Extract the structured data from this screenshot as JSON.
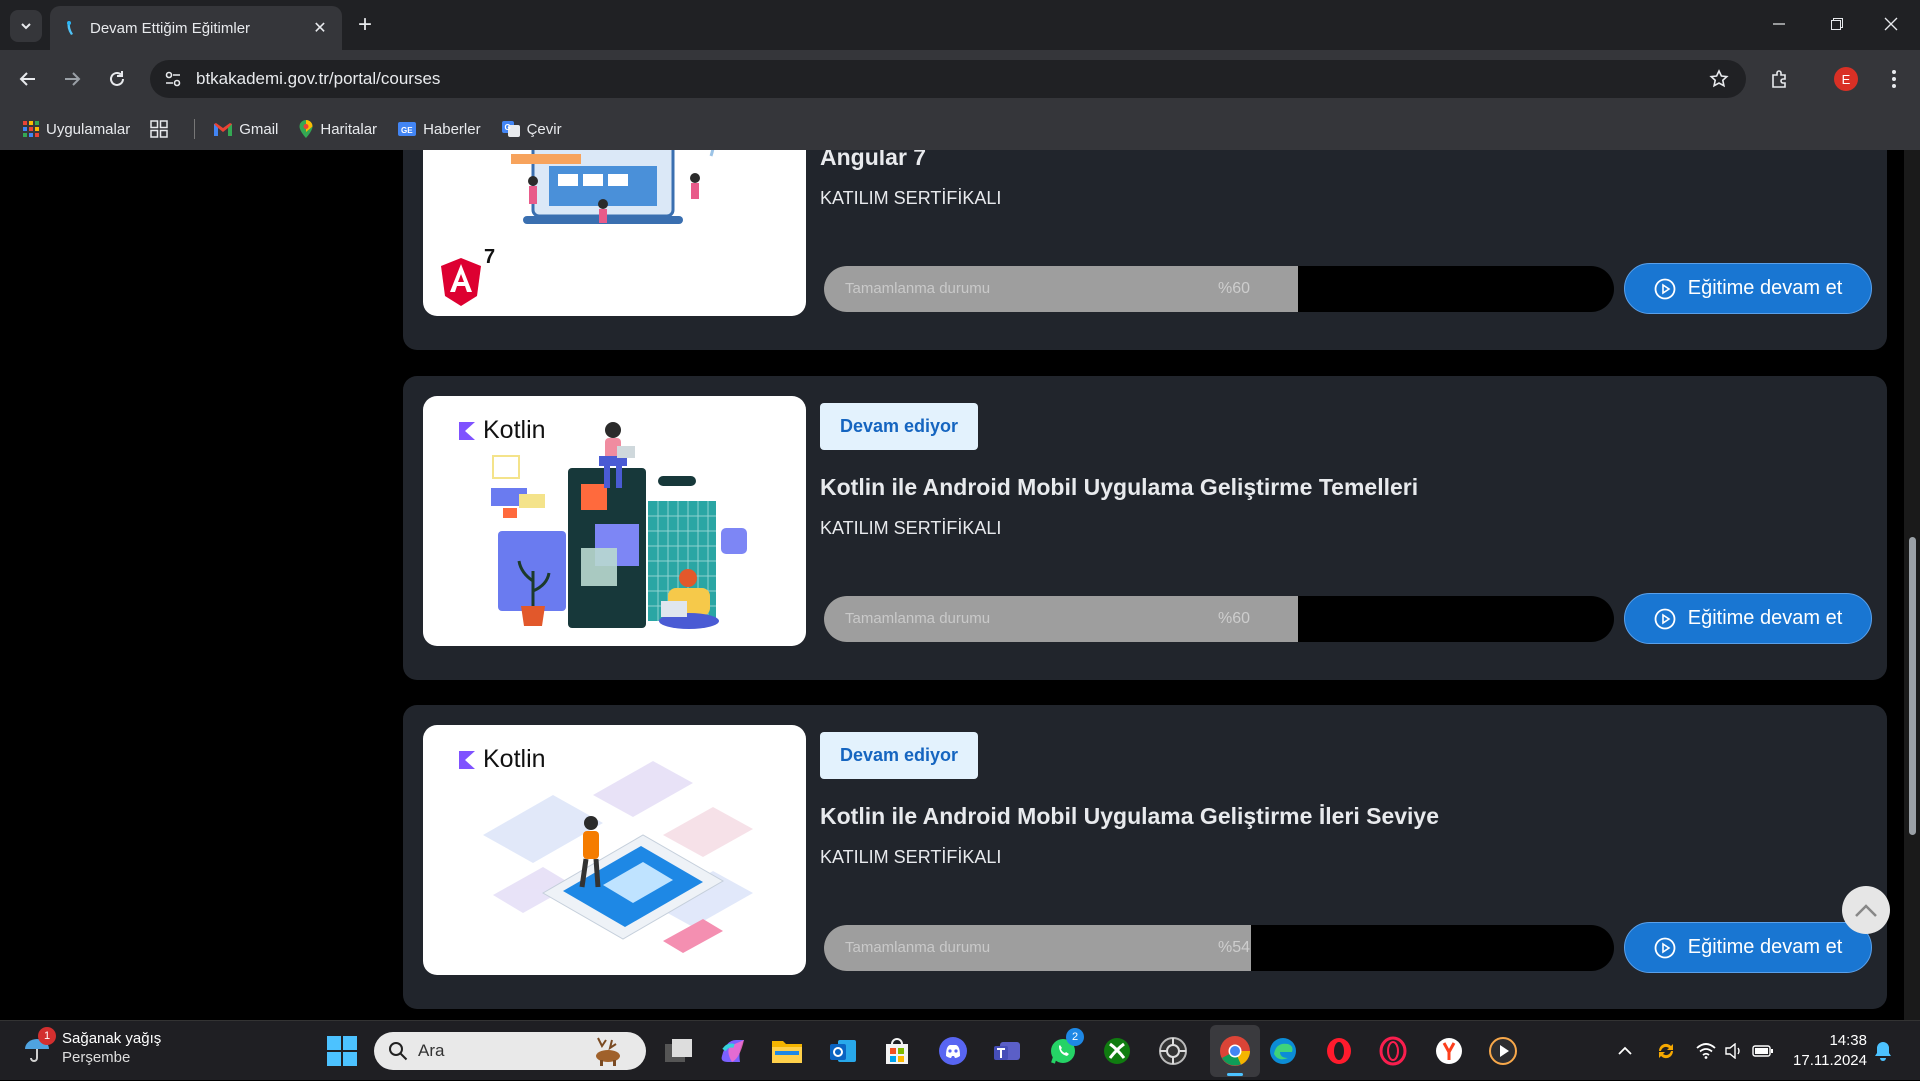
{
  "browser": {
    "tab_title": "Devam Ettiğim Eğitimler",
    "url": "btkakademi.gov.tr/portal/courses",
    "profile_initial": "E",
    "bookmarks": [
      {
        "label": "Uygulamalar",
        "icon": "apps-grid-icon"
      },
      {
        "label": "",
        "icon": "tab-groups-icon"
      },
      {
        "label": "Gmail",
        "icon": "gmail-icon"
      },
      {
        "label": "Haritalar",
        "icon": "maps-icon"
      },
      {
        "label": "Haberler",
        "icon": "news-icon"
      },
      {
        "label": "Çevir",
        "icon": "translate-icon"
      }
    ]
  },
  "courses": [
    {
      "title": "Angular 7",
      "certificate": "KATILIM SERTİFİKALI",
      "progress_label": "Tamamlanma durumu",
      "progress_text": "%60",
      "progress": 0.6,
      "button_label": "Eğitime devam et",
      "thumb_text": "7"
    },
    {
      "badge": "Devam ediyor",
      "title": "Kotlin ile Android Mobil Uygulama Geliştirme Temelleri",
      "certificate": "KATILIM SERTİFİKALI",
      "progress_label": "Tamamlanma durumu",
      "progress_text": "%60",
      "progress": 0.6,
      "button_label": "Eğitime devam et",
      "thumb_text": "Kotlin"
    },
    {
      "badge": "Devam ediyor",
      "title": "Kotlin ile Android Mobil Uygulama Geliştirme İleri Seviye",
      "certificate": "KATILIM SERTİFİKALI",
      "progress_label": "Tamamlanma durumu",
      "progress_text": "%54",
      "progress": 0.54,
      "button_label": "Eğitime devam et",
      "thumb_text": "Kotlin"
    }
  ],
  "taskbar": {
    "weather_badge": "1",
    "weather_title": "Sağanak yağış",
    "weather_day": "Perşembe",
    "search_placeholder": "Ara",
    "whatsapp_badge": "2",
    "time": "14:38",
    "date": "17.11.2024"
  },
  "colors": {
    "accent": "#1976d2",
    "badge_bg": "#e3f2fd",
    "card_bg": "#21252c",
    "progress_fill": "#9e9e9e"
  }
}
